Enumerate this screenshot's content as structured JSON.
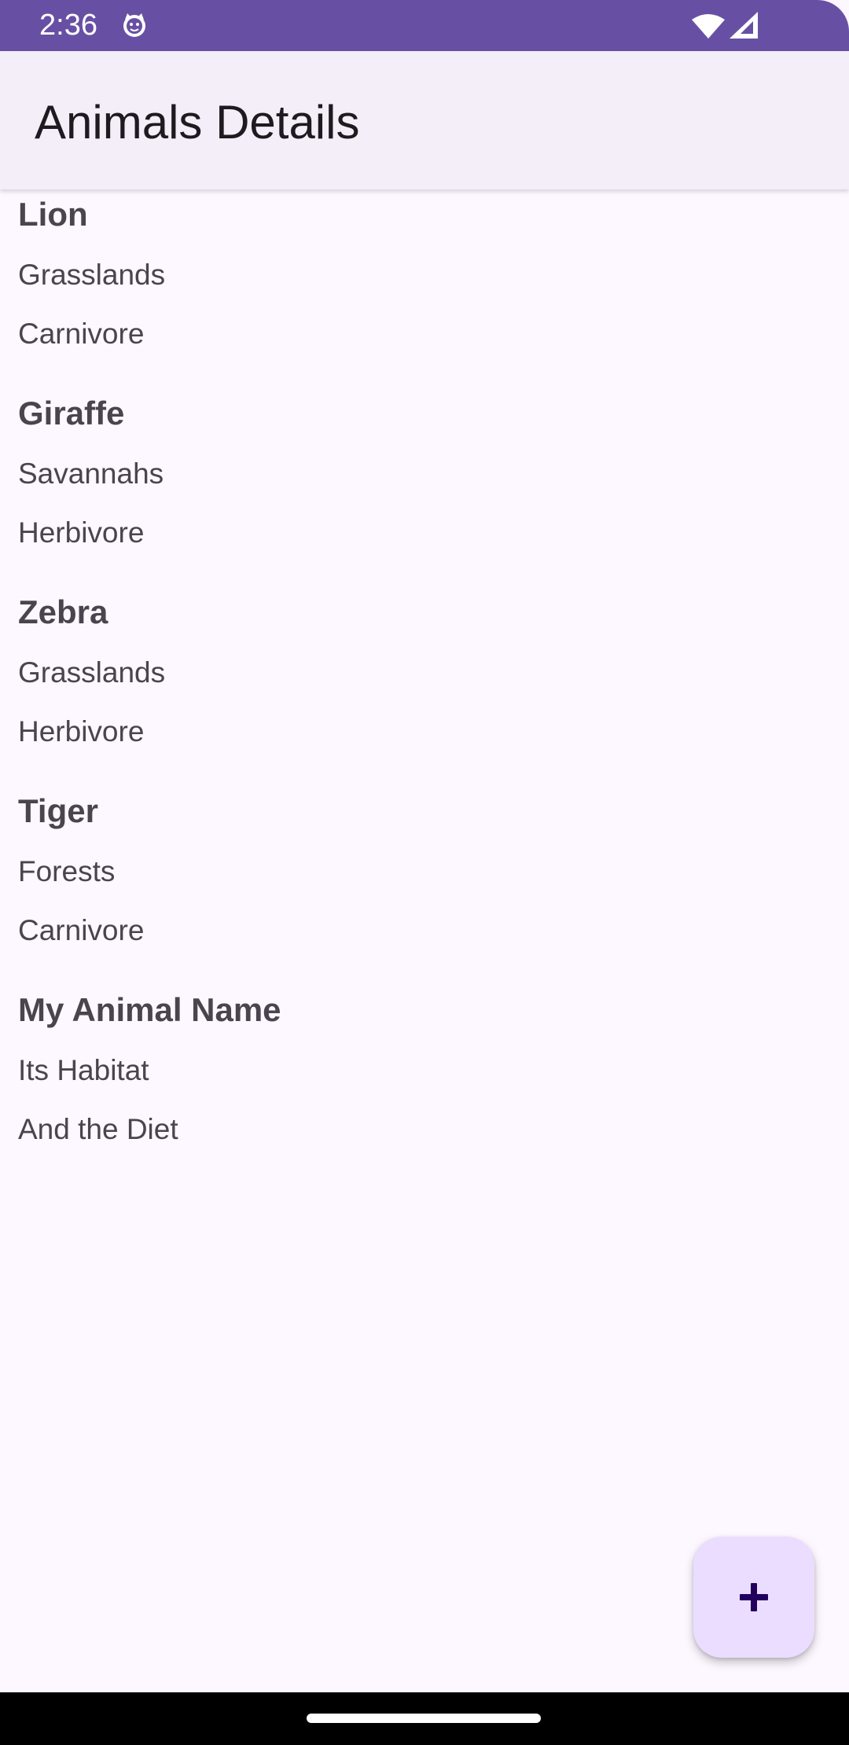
{
  "status_bar": {
    "time": "2:36",
    "app_icon": "cat-face-icon",
    "wifi_icon": "wifi-icon",
    "signal_icon": "cell-signal-icon",
    "color": "#6750a4"
  },
  "app_bar": {
    "title": "Animals Details"
  },
  "animals": [
    {
      "name": "Lion",
      "habitat": "Grasslands",
      "diet": "Carnivore"
    },
    {
      "name": "Giraffe",
      "habitat": "Savannahs",
      "diet": "Herbivore"
    },
    {
      "name": "Zebra",
      "habitat": "Grasslands",
      "diet": "Herbivore"
    },
    {
      "name": "Tiger",
      "habitat": "Forests",
      "diet": "Carnivore"
    },
    {
      "name": "My Animal Name",
      "habitat": "Its Habitat",
      "diet": "And the Diet"
    }
  ],
  "fab": {
    "icon": "plus-icon",
    "color": "#eaddff",
    "icon_color": "#21005d"
  },
  "colors": {
    "background": "#fdf7ff",
    "app_bar": "#f3eef7",
    "text_primary": "#1d1b20",
    "text_secondary": "#49454f"
  }
}
